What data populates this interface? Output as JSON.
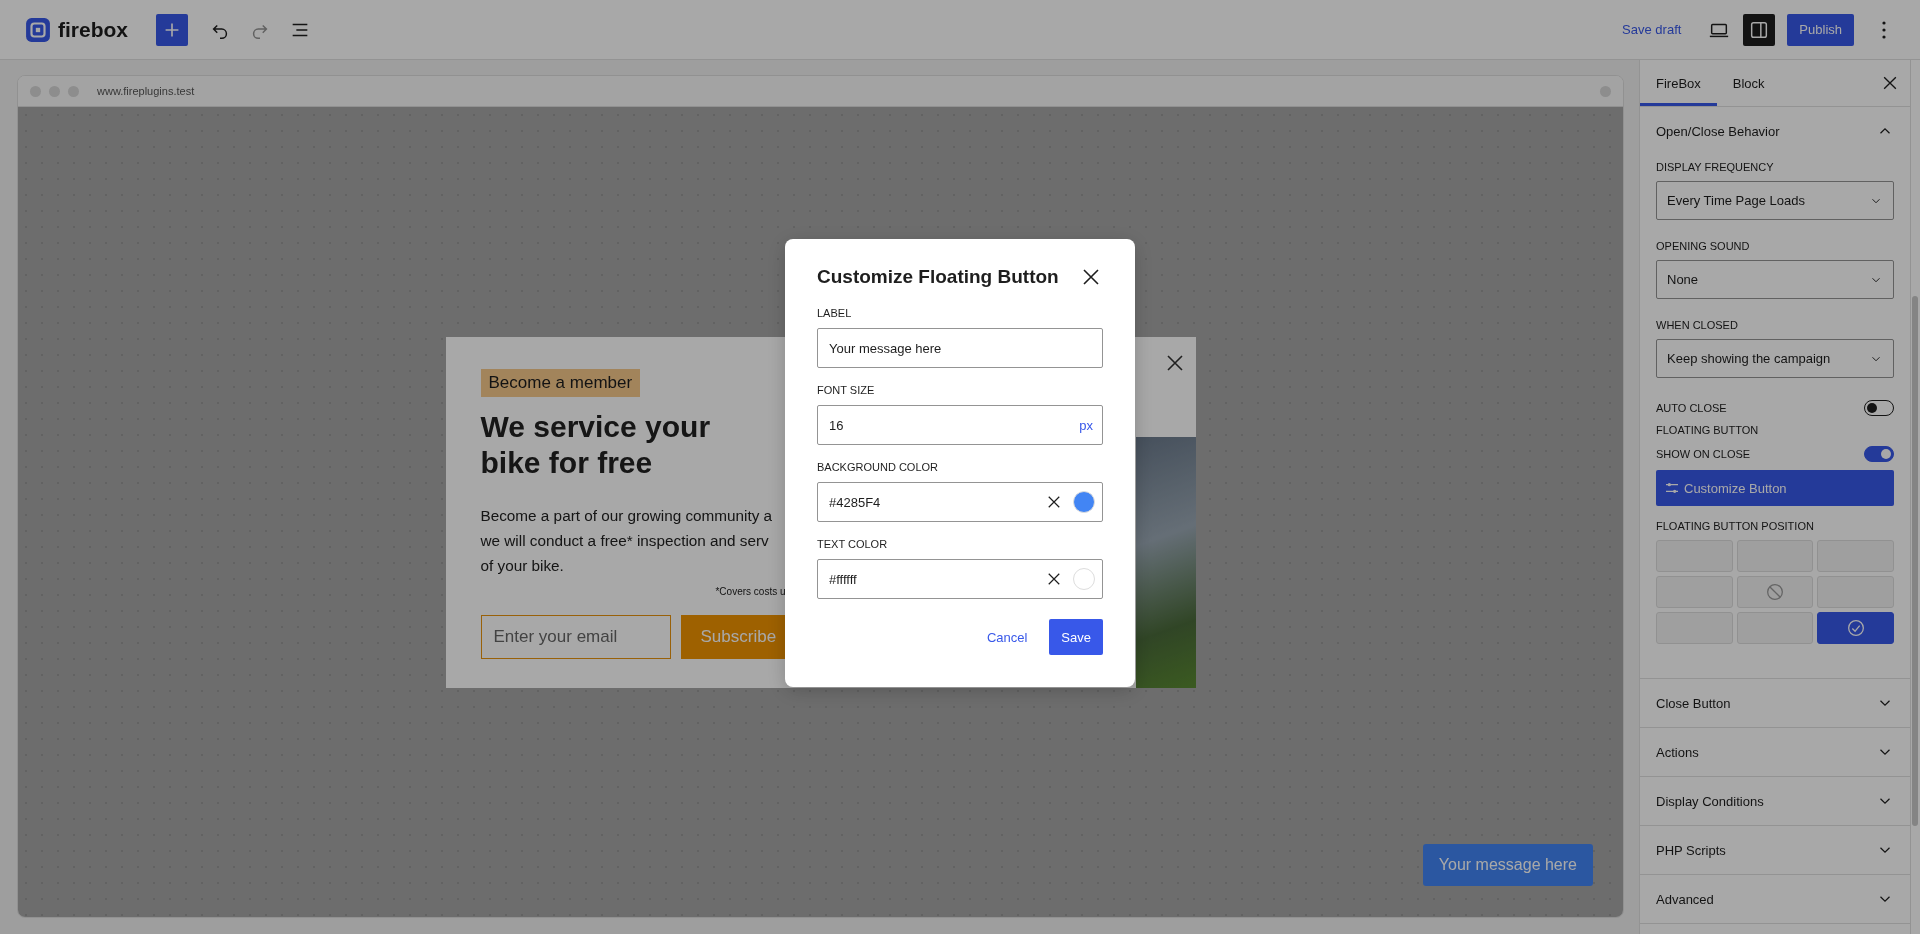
{
  "topbar": {
    "logo": "firebox",
    "save_draft": "Save draft",
    "publish": "Publish",
    "sidebar_toggle_on": true
  },
  "preview": {
    "address": "www.fireplugins.test",
    "popup": {
      "badge": "Become a member",
      "heading": "We service your bike for free",
      "body_lines": [
        "Become a part of our growing community a",
        "we will conduct a free* inspection and serv",
        "of your bike."
      ],
      "footnote": "*Covers costs u",
      "email_placeholder": "Enter your email",
      "subscribe": "Subscribe"
    },
    "floating_button": {
      "label": "Your message here"
    }
  },
  "sidebar": {
    "tabs": [
      {
        "label": "FireBox",
        "selected": true
      },
      {
        "label": "Block",
        "selected": false
      }
    ],
    "open_section": {
      "title": "Open/Close Behavior",
      "expanded": true,
      "fields": [
        {
          "kind": "select",
          "label": "DISPLAY FREQUENCY",
          "value": "Every Time Page Loads"
        },
        {
          "kind": "select",
          "label": "OPENING SOUND",
          "value": "None"
        },
        {
          "kind": "select",
          "label": "WHEN CLOSED",
          "value": "Keep showing the campaign"
        },
        {
          "kind": "toggle",
          "label": "AUTO CLOSE",
          "on": false
        },
        {
          "kind": "heading",
          "label": "FLOATING BUTTON"
        },
        {
          "kind": "toggle",
          "label": "SHOW ON CLOSE",
          "on": true
        },
        {
          "kind": "button",
          "label": "Customize Button"
        },
        {
          "kind": "position",
          "label": "FLOATING BUTTON POSITION",
          "cells": [
            {
              "kind": "slot",
              "selected": false
            },
            {
              "kind": "slot",
              "selected": false
            },
            {
              "kind": "slot",
              "selected": false
            },
            {
              "kind": "slot",
              "selected": false
            },
            {
              "kind": "unavailable",
              "selected": false
            },
            {
              "kind": "slot",
              "selected": false
            },
            {
              "kind": "slot",
              "selected": false
            },
            {
              "kind": "slot",
              "selected": false
            },
            {
              "kind": "slot",
              "selected": true
            }
          ]
        }
      ]
    },
    "sections": [
      {
        "title": "Close Button",
        "expanded": false
      },
      {
        "title": "Actions",
        "expanded": false
      },
      {
        "title": "Display Conditions",
        "expanded": false
      },
      {
        "title": "PHP Scripts",
        "expanded": false
      },
      {
        "title": "Advanced",
        "expanded": false
      }
    ]
  },
  "modal": {
    "title": "Customize Floating Button",
    "fields": [
      {
        "kind": "text",
        "label": "LABEL",
        "value": "Your message here"
      },
      {
        "kind": "number",
        "label": "FONT SIZE",
        "value": "16",
        "unit": "px"
      },
      {
        "kind": "color",
        "label": "BACKGROUND COLOR",
        "value": "#4285F4"
      },
      {
        "kind": "color",
        "label": "TEXT COLOR",
        "value": "#ffffff"
      }
    ],
    "cancel": "Cancel",
    "save": "Save"
  }
}
